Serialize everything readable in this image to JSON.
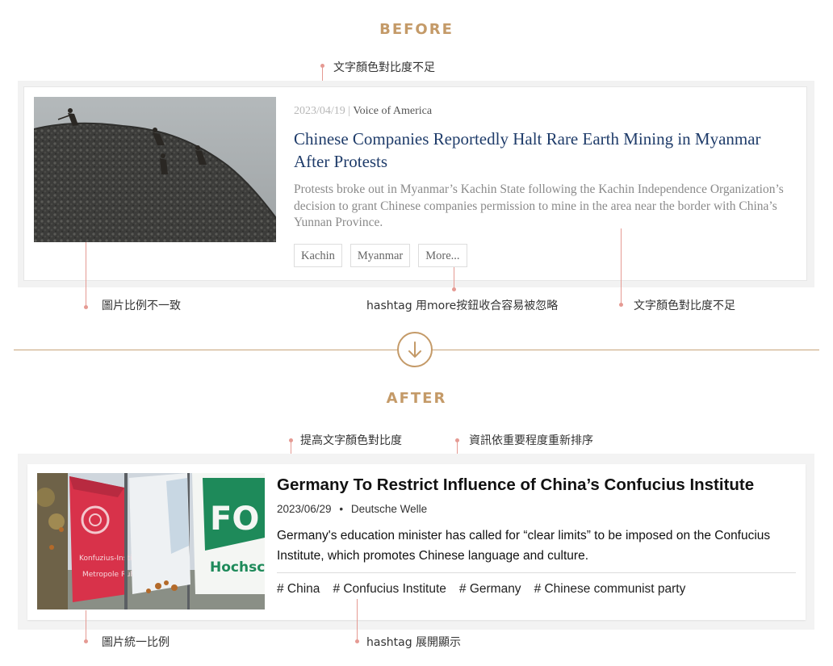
{
  "before": {
    "heading": "BEFORE",
    "annotations": {
      "text_contrast_top": "文字顏色對比度不足",
      "image_ratio": "圖片比例不一致",
      "hashtag_more": "hashtag 用more按鈕收合容易被忽略",
      "text_contrast_right": "文字顏色對比度不足"
    },
    "article": {
      "date": "2023/04/19",
      "separator": "|",
      "source": "Voice of America",
      "title": "Chinese Companies Reportedly Halt Rare Earth Mining in Myanmar After Protests",
      "description": "Protests broke out in Myanmar’s Kachin State following the Kachin Independence Organization’s decision to grant Chinese companies permission to mine in the area near the border with China’s Yunnan Province.",
      "tags": [
        "Kachin",
        "Myanmar",
        "More..."
      ]
    }
  },
  "after": {
    "heading": "AFTER",
    "annotations": {
      "improve_contrast": "提高文字顏色對比度",
      "reorder": "資訊依重要程度重新排序",
      "image_ratio": "圖片統一比例",
      "hashtag_expand": "hashtag 展開顯示"
    },
    "article": {
      "title": "Germany To Restrict Influence of China’s Confucius Institute",
      "date": "2023/06/29",
      "bullet": "•",
      "source": "Deutsche Welle",
      "description": "Germany's education minister has called for “clear limits” to be imposed on the Confucius Institute, which promotes Chinese language and culture.",
      "tags": [
        "# China",
        "# Confucius Institute",
        "# Germany",
        "# Chinese communist party"
      ]
    },
    "flag_texts": {
      "red_flag_line1": "Konfuzius-Institut",
      "red_flag_line2": "Metropole Ruhr",
      "green_flag_line1": "FO",
      "green_flag_line2": "Hochsc"
    }
  },
  "colors": {
    "accent_gold": "#c49a68",
    "annotation_pink": "#e59a93",
    "before_title_blue": "#1f3c6a",
    "before_desc_gray": "#8a8a8a"
  },
  "icons": {
    "divider": "arrow-down-icon"
  }
}
